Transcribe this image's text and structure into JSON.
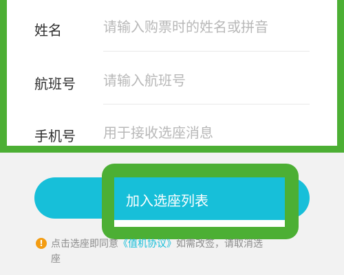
{
  "form": {
    "fields": [
      {
        "label": "姓名",
        "placeholder": "请输入购票时的姓名或拼音"
      },
      {
        "label": "航班号",
        "placeholder": "请输入航班号"
      },
      {
        "label": "手机号",
        "placeholder": "用于接收选座消息"
      }
    ]
  },
  "add_button": {
    "label": "加入选座列表"
  },
  "notice": {
    "prefix": "点击选座即同意",
    "link": "《值机协议》",
    "suffix": "如需改签，请取消选",
    "continuation": "座"
  },
  "colors": {
    "accent": "#17bfd9",
    "highlight": "#4caf34",
    "warning": "#f39c12"
  }
}
